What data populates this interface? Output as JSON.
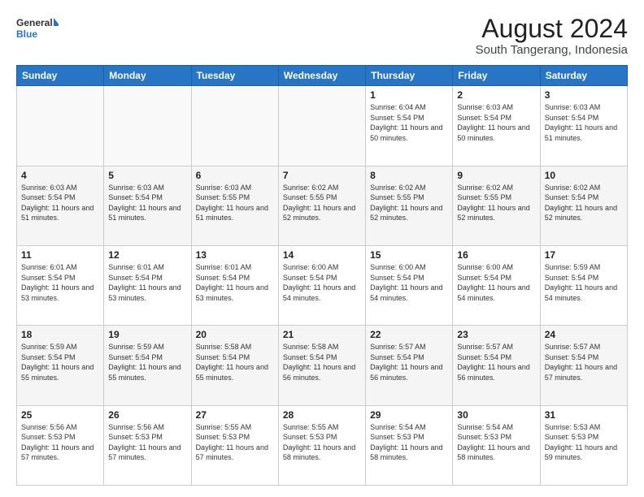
{
  "header": {
    "logo_line1": "General",
    "logo_line2": "Blue",
    "main_title": "August 2024",
    "sub_title": "South Tangerang, Indonesia"
  },
  "weekdays": [
    "Sunday",
    "Monday",
    "Tuesday",
    "Wednesday",
    "Thursday",
    "Friday",
    "Saturday"
  ],
  "weeks": [
    [
      {
        "day": "",
        "sunrise": "",
        "sunset": "",
        "daylight": ""
      },
      {
        "day": "",
        "sunrise": "",
        "sunset": "",
        "daylight": ""
      },
      {
        "day": "",
        "sunrise": "",
        "sunset": "",
        "daylight": ""
      },
      {
        "day": "",
        "sunrise": "",
        "sunset": "",
        "daylight": ""
      },
      {
        "day": "1",
        "sunrise": "Sunrise: 6:04 AM",
        "sunset": "Sunset: 5:54 PM",
        "daylight": "Daylight: 11 hours and 50 minutes."
      },
      {
        "day": "2",
        "sunrise": "Sunrise: 6:03 AM",
        "sunset": "Sunset: 5:54 PM",
        "daylight": "Daylight: 11 hours and 50 minutes."
      },
      {
        "day": "3",
        "sunrise": "Sunrise: 6:03 AM",
        "sunset": "Sunset: 5:54 PM",
        "daylight": "Daylight: 11 hours and 51 minutes."
      }
    ],
    [
      {
        "day": "4",
        "sunrise": "Sunrise: 6:03 AM",
        "sunset": "Sunset: 5:54 PM",
        "daylight": "Daylight: 11 hours and 51 minutes."
      },
      {
        "day": "5",
        "sunrise": "Sunrise: 6:03 AM",
        "sunset": "Sunset: 5:54 PM",
        "daylight": "Daylight: 11 hours and 51 minutes."
      },
      {
        "day": "6",
        "sunrise": "Sunrise: 6:03 AM",
        "sunset": "Sunset: 5:55 PM",
        "daylight": "Daylight: 11 hours and 51 minutes."
      },
      {
        "day": "7",
        "sunrise": "Sunrise: 6:02 AM",
        "sunset": "Sunset: 5:55 PM",
        "daylight": "Daylight: 11 hours and 52 minutes."
      },
      {
        "day": "8",
        "sunrise": "Sunrise: 6:02 AM",
        "sunset": "Sunset: 5:55 PM",
        "daylight": "Daylight: 11 hours and 52 minutes."
      },
      {
        "day": "9",
        "sunrise": "Sunrise: 6:02 AM",
        "sunset": "Sunset: 5:55 PM",
        "daylight": "Daylight: 11 hours and 52 minutes."
      },
      {
        "day": "10",
        "sunrise": "Sunrise: 6:02 AM",
        "sunset": "Sunset: 5:54 PM",
        "daylight": "Daylight: 11 hours and 52 minutes."
      }
    ],
    [
      {
        "day": "11",
        "sunrise": "Sunrise: 6:01 AM",
        "sunset": "Sunset: 5:54 PM",
        "daylight": "Daylight: 11 hours and 53 minutes."
      },
      {
        "day": "12",
        "sunrise": "Sunrise: 6:01 AM",
        "sunset": "Sunset: 5:54 PM",
        "daylight": "Daylight: 11 hours and 53 minutes."
      },
      {
        "day": "13",
        "sunrise": "Sunrise: 6:01 AM",
        "sunset": "Sunset: 5:54 PM",
        "daylight": "Daylight: 11 hours and 53 minutes."
      },
      {
        "day": "14",
        "sunrise": "Sunrise: 6:00 AM",
        "sunset": "Sunset: 5:54 PM",
        "daylight": "Daylight: 11 hours and 54 minutes."
      },
      {
        "day": "15",
        "sunrise": "Sunrise: 6:00 AM",
        "sunset": "Sunset: 5:54 PM",
        "daylight": "Daylight: 11 hours and 54 minutes."
      },
      {
        "day": "16",
        "sunrise": "Sunrise: 6:00 AM",
        "sunset": "Sunset: 5:54 PM",
        "daylight": "Daylight: 11 hours and 54 minutes."
      },
      {
        "day": "17",
        "sunrise": "Sunrise: 5:59 AM",
        "sunset": "Sunset: 5:54 PM",
        "daylight": "Daylight: 11 hours and 54 minutes."
      }
    ],
    [
      {
        "day": "18",
        "sunrise": "Sunrise: 5:59 AM",
        "sunset": "Sunset: 5:54 PM",
        "daylight": "Daylight: 11 hours and 55 minutes."
      },
      {
        "day": "19",
        "sunrise": "Sunrise: 5:59 AM",
        "sunset": "Sunset: 5:54 PM",
        "daylight": "Daylight: 11 hours and 55 minutes."
      },
      {
        "day": "20",
        "sunrise": "Sunrise: 5:58 AM",
        "sunset": "Sunset: 5:54 PM",
        "daylight": "Daylight: 11 hours and 55 minutes."
      },
      {
        "day": "21",
        "sunrise": "Sunrise: 5:58 AM",
        "sunset": "Sunset: 5:54 PM",
        "daylight": "Daylight: 11 hours and 56 minutes."
      },
      {
        "day": "22",
        "sunrise": "Sunrise: 5:57 AM",
        "sunset": "Sunset: 5:54 PM",
        "daylight": "Daylight: 11 hours and 56 minutes."
      },
      {
        "day": "23",
        "sunrise": "Sunrise: 5:57 AM",
        "sunset": "Sunset: 5:54 PM",
        "daylight": "Daylight: 11 hours and 56 minutes."
      },
      {
        "day": "24",
        "sunrise": "Sunrise: 5:57 AM",
        "sunset": "Sunset: 5:54 PM",
        "daylight": "Daylight: 11 hours and 57 minutes."
      }
    ],
    [
      {
        "day": "25",
        "sunrise": "Sunrise: 5:56 AM",
        "sunset": "Sunset: 5:53 PM",
        "daylight": "Daylight: 11 hours and 57 minutes."
      },
      {
        "day": "26",
        "sunrise": "Sunrise: 5:56 AM",
        "sunset": "Sunset: 5:53 PM",
        "daylight": "Daylight: 11 hours and 57 minutes."
      },
      {
        "day": "27",
        "sunrise": "Sunrise: 5:55 AM",
        "sunset": "Sunset: 5:53 PM",
        "daylight": "Daylight: 11 hours and 57 minutes."
      },
      {
        "day": "28",
        "sunrise": "Sunrise: 5:55 AM",
        "sunset": "Sunset: 5:53 PM",
        "daylight": "Daylight: 11 hours and 58 minutes."
      },
      {
        "day": "29",
        "sunrise": "Sunrise: 5:54 AM",
        "sunset": "Sunset: 5:53 PM",
        "daylight": "Daylight: 11 hours and 58 minutes."
      },
      {
        "day": "30",
        "sunrise": "Sunrise: 5:54 AM",
        "sunset": "Sunset: 5:53 PM",
        "daylight": "Daylight: 11 hours and 58 minutes."
      },
      {
        "day": "31",
        "sunrise": "Sunrise: 5:53 AM",
        "sunset": "Sunset: 5:53 PM",
        "daylight": "Daylight: 11 hours and 59 minutes."
      }
    ]
  ]
}
